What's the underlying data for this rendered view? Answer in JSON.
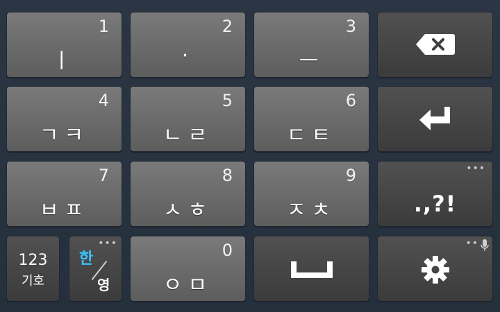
{
  "keyboard": {
    "rows": [
      [
        {
          "name": "key-1",
          "number": "1",
          "label": "ㅣ"
        },
        {
          "name": "key-2",
          "number": "2",
          "label": "·"
        },
        {
          "name": "key-3",
          "number": "3",
          "label": "ㅡ"
        }
      ],
      [
        {
          "name": "key-4",
          "number": "4",
          "label": "ㄱㅋ"
        },
        {
          "name": "key-5",
          "number": "5",
          "label": "ㄴㄹ"
        },
        {
          "name": "key-6",
          "number": "6",
          "label": "ㄷㅌ"
        }
      ],
      [
        {
          "name": "key-7",
          "number": "7",
          "label": "ㅂㅍ"
        },
        {
          "name": "key-8",
          "number": "8",
          "label": "ㅅㅎ"
        },
        {
          "name": "key-9",
          "number": "9",
          "label": "ㅈㅊ"
        }
      ]
    ],
    "key0": {
      "number": "0",
      "label": "ㅇㅁ"
    },
    "mode_key": {
      "line1": "123",
      "line2": "기호"
    },
    "lang_key": {
      "han": "한",
      "yeong": "영",
      "dots": "•••"
    },
    "punct_key": {
      "label": ".,?!",
      "dots": "•••"
    },
    "settings_key": {
      "dots": "••"
    },
    "icons": {
      "backspace": "backspace-icon",
      "enter": "enter-icon",
      "space": "space-icon",
      "settings": "gear-icon",
      "mic": "microphone-icon"
    },
    "colors": {
      "background": "#2b3543",
      "key_light": "#6b6b6b",
      "key_dark": "#464646",
      "han_accent": "#3cc3ff"
    }
  }
}
